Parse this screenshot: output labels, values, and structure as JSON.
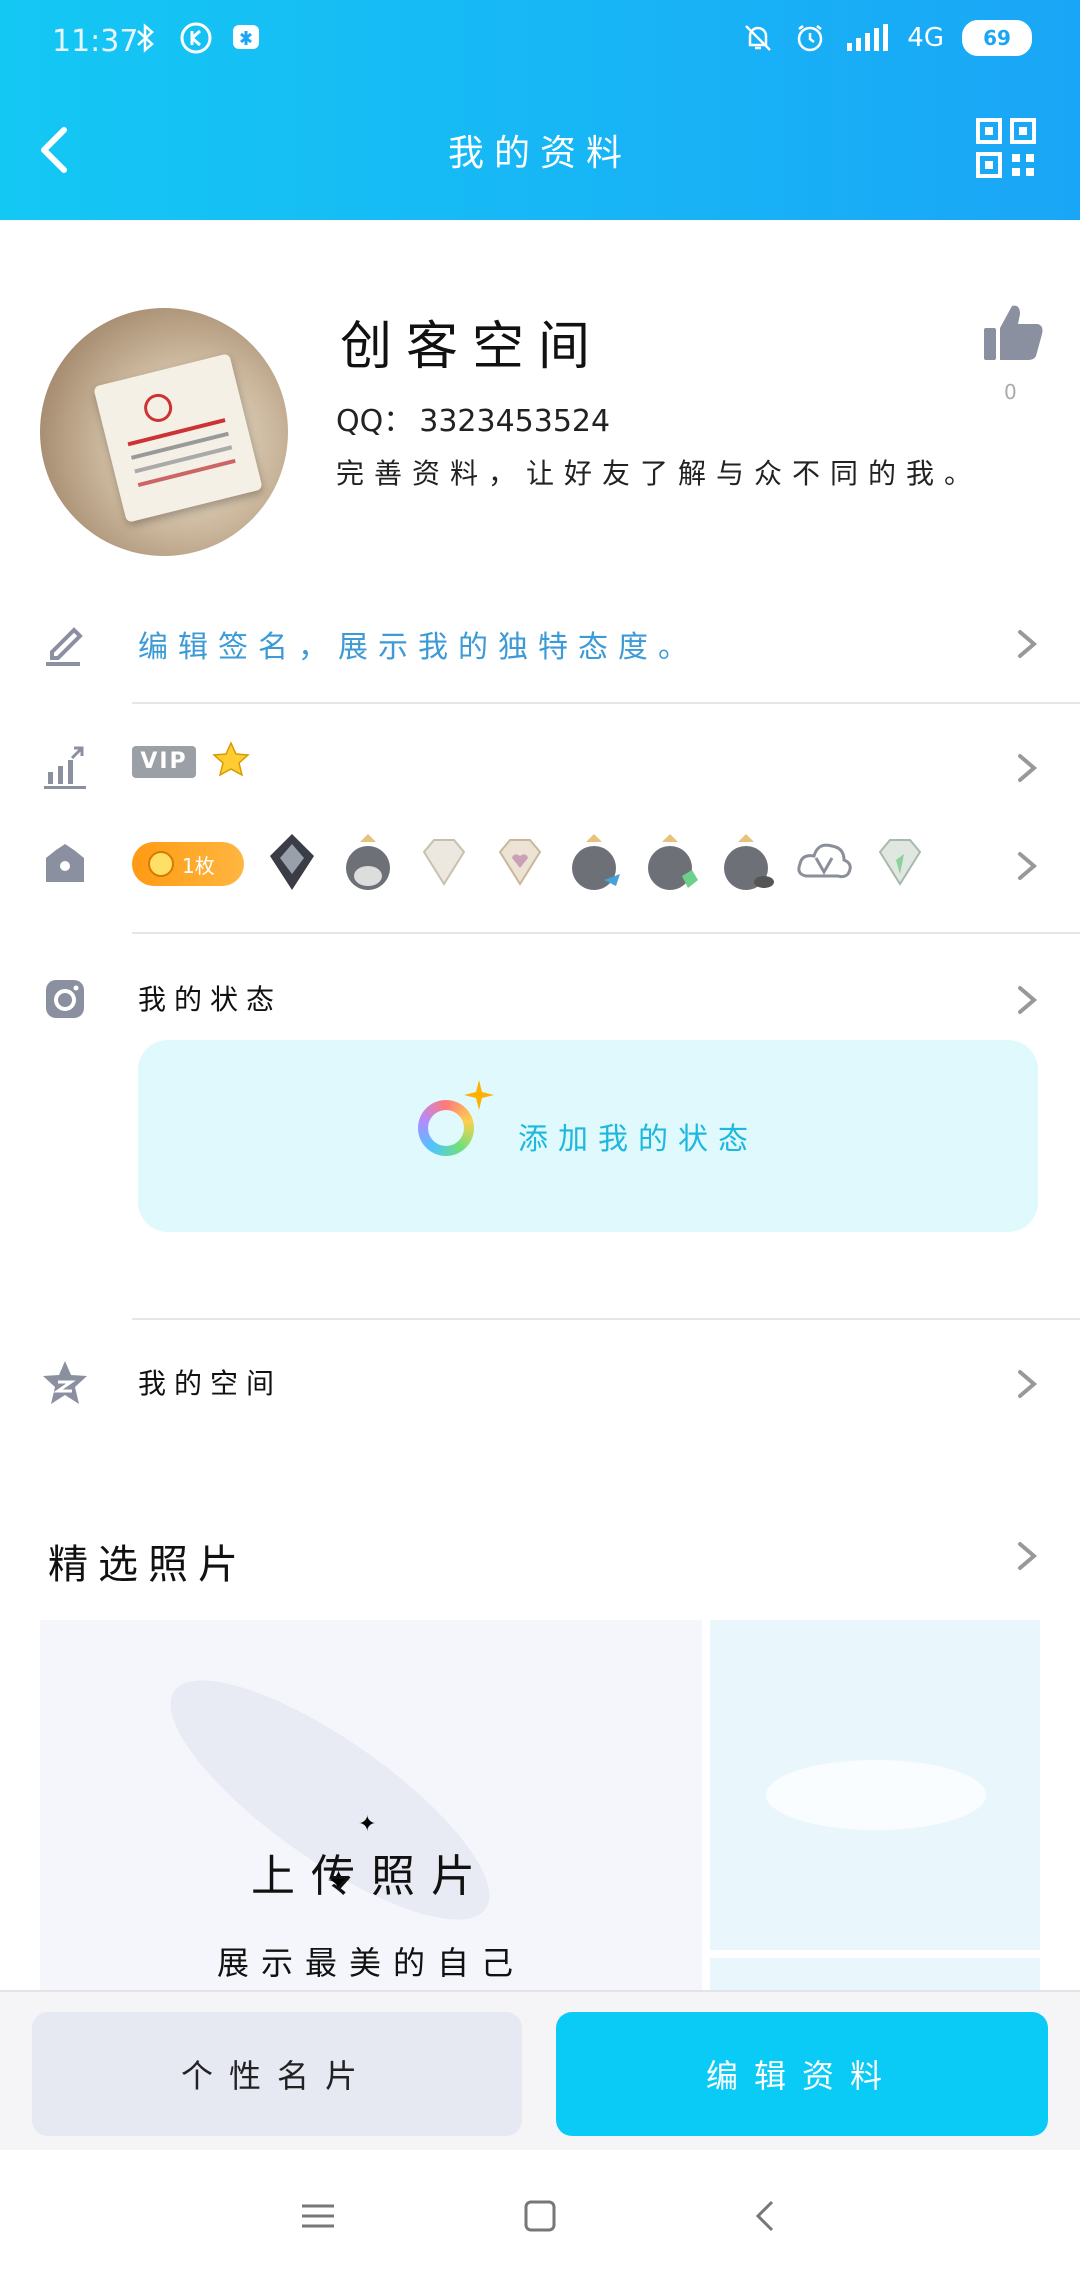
{
  "status_bar": {
    "time": "11:37",
    "network": "4G",
    "battery": "69"
  },
  "nav": {
    "title": "我的资料"
  },
  "profile": {
    "nickname": "创客空间",
    "qq_label": "QQ：",
    "qq_number": "3323453524",
    "intro": "完善资料，让好友了解与众不同的我。",
    "like_count": "0"
  },
  "signature": {
    "text": "编辑签名，展示我的独特态度。"
  },
  "vip": {
    "tag": "VIP"
  },
  "medals": {
    "count": "1枚"
  },
  "my_status": {
    "label": "我的状态",
    "add_label": "添加我的状态"
  },
  "my_space": {
    "label": "我的空间"
  },
  "photos": {
    "title": "精选照片",
    "upload_title": "上传照片",
    "upload_sub": "展示最美的自己"
  },
  "bottom": {
    "card_label": "个性名片",
    "edit_label": "编辑资料"
  },
  "colors": {
    "header": "#14c8f4",
    "accent": "#09cbf6",
    "signature_blue": "#3c9ad6"
  }
}
